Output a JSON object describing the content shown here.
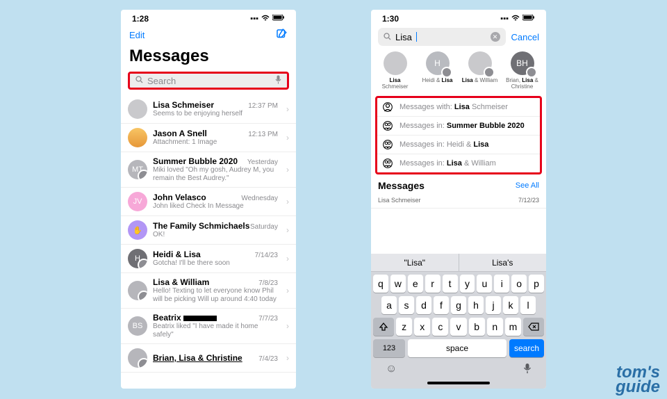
{
  "left": {
    "time": "1:28",
    "edit": "Edit",
    "title": "Messages",
    "search_placeholder": "Search",
    "conversations": [
      {
        "name": "Lisa Schmeiser",
        "time": "12:37 PM",
        "preview": "Seems to be enjoying herself"
      },
      {
        "name": "Jason A Snell",
        "time": "12:13 PM",
        "preview": "Attachment: 1 Image"
      },
      {
        "name": "Summer Bubble 2020",
        "time": "Yesterday",
        "preview": "Miki loved \"Oh my gosh, Audrey M, you remain the Best Audrey.\""
      },
      {
        "name": "John Velasco",
        "time": "Wednesday",
        "preview": "John liked Check In Message"
      },
      {
        "name": "The Family Schmichaels",
        "time": "Saturday",
        "preview": "OK!"
      },
      {
        "name": "Heidi & Lisa",
        "time": "7/14/23",
        "preview": "Gotcha! I'll be there soon"
      },
      {
        "name": "Lisa & William",
        "time": "7/8/23",
        "preview": "Hello! Texting to let everyone know Phil will be picking Will up around 4:40 today"
      },
      {
        "name": "Beatrix",
        "time": "7/7/23",
        "preview": "Beatrix liked \"I have made it home safely\""
      },
      {
        "name": "Brian, Lisa & Christine",
        "time": "7/4/23",
        "preview": ""
      }
    ]
  },
  "right": {
    "time": "1:30",
    "query": "Lisa",
    "cancel": "Cancel",
    "suggestions_people": [
      {
        "label_plain_pre": "",
        "label_bold": "Lisa",
        "label_plain_post": " Schmeiser",
        "initials": ""
      },
      {
        "label_plain_pre": "Heidi & ",
        "label_bold": "Lisa",
        "label_plain_post": "",
        "initials": "H"
      },
      {
        "label_plain_pre": "",
        "label_bold": "Lisa",
        "label_plain_post": " & William",
        "initials": ""
      },
      {
        "label_plain_pre": "Brian, ",
        "label_bold": "Lisa",
        "label_plain_post": " & Christine",
        "initials": "BH"
      }
    ],
    "suggestions_lines": [
      {
        "prefix": "Messages with: ",
        "bold": "Lisa",
        "post": " Schmeiser",
        "type": "person"
      },
      {
        "prefix": "Messages in: ",
        "bold": "Summer Bubble 2020",
        "post": "",
        "type": "group"
      },
      {
        "prefix": "Messages in: ",
        "bold": "",
        "post": "Heidi & ",
        "bold2": "Lisa",
        "type": "group"
      },
      {
        "prefix": "Messages in: ",
        "bold": "Lisa",
        "post": " & William",
        "type": "group"
      }
    ],
    "messages_header": "Messages",
    "see_all": "See All",
    "message_result": {
      "name": "Lisa Schmeiser",
      "date": "7/12/23"
    },
    "predictions": [
      "\"Lisa\"",
      "Lisa's"
    ],
    "keys_row1": [
      "q",
      "w",
      "e",
      "r",
      "t",
      "y",
      "u",
      "i",
      "o",
      "p"
    ],
    "keys_row2": [
      "a",
      "s",
      "d",
      "f",
      "g",
      "h",
      "j",
      "k",
      "l"
    ],
    "keys_row3": [
      "z",
      "x",
      "c",
      "v",
      "b",
      "n",
      "m"
    ],
    "key_123": "123",
    "key_space": "space",
    "key_search": "search"
  },
  "watermark_top": "tom's",
  "watermark_bottom": "guide"
}
